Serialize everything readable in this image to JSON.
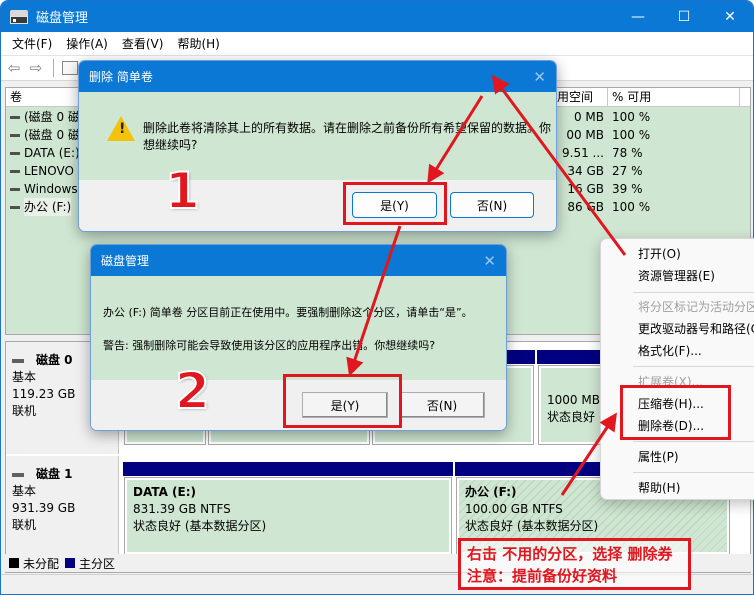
{
  "window": {
    "title": "磁盘管理",
    "controls": {
      "minimize": "—",
      "maximize": "☐",
      "close": "✕"
    }
  },
  "menubar": [
    "文件(F)",
    "操作(A)",
    "查看(V)",
    "帮助(H)"
  ],
  "volume_list": {
    "headers": {
      "volume": "卷",
      "free": "用空间",
      "pct_free": "% 可用"
    },
    "rows": [
      {
        "name": "(磁盘 0 磁",
        "free": "0 MB",
        "pct": "100 %"
      },
      {
        "name": "(磁盘 0 磁",
        "free": "00 MB",
        "pct": "100 %"
      },
      {
        "name": "DATA (E:)",
        "free": "9.51 ...",
        "pct": "78 %"
      },
      {
        "name": "LENOVO",
        "free": "34 GB",
        "pct": "27 %"
      },
      {
        "name": "Windows",
        "free": "16 GB",
        "pct": "39 %"
      },
      {
        "name": "办公 (F:)",
        "free": "86 GB",
        "pct": "100 %"
      }
    ]
  },
  "disks": [
    {
      "name": "磁盘 0",
      "type": "基本",
      "size": "119.23 GB",
      "status": "联机"
    },
    {
      "name": "磁盘 1",
      "type": "基本",
      "size": "931.39 GB",
      "status": "联机"
    }
  ],
  "partitions": {
    "disk0_right": {
      "size": "1000 MB",
      "status": "状态良好 ("
    },
    "data": {
      "name": "DATA  (E:)",
      "size": "831.39 GB NTFS",
      "status": "状态良好 (基本数据分区)"
    },
    "office": {
      "name": "办公  (F:)",
      "size": "100.00 GB NTFS",
      "status": "状态良好 (基本数据分区)"
    }
  },
  "legend": {
    "unallocated": "未分配",
    "primary": "主分区",
    "unallocated_color": "#000000",
    "primary_color": "#000080"
  },
  "dialog1": {
    "title": "删除 简单卷",
    "message_line1": "删除此卷将清除其上的所有数据。请在删除之前备份所有希望保留的数据。你",
    "message_line2": "想继续吗?",
    "yes": "是(Y)",
    "no": "否(N)",
    "close": "✕"
  },
  "dialog2": {
    "title": "磁盘管理",
    "message": "办公 (F:) 简单卷 分区目前正在使用中。要强制删除这个分区，请单击“是”。",
    "warning": "警告: 强制删除可能会导致使用该分区的应用程序出错。你想继续吗?",
    "yes": "是(Y)",
    "no": "否(N)",
    "close": "✕"
  },
  "context_menu": [
    {
      "label": "打开(O)",
      "disabled": false
    },
    {
      "label": "资源管理器(E)",
      "disabled": false
    },
    {
      "label": "将分区标记为活动分区",
      "disabled": true
    },
    {
      "label": "更改驱动器号和路径(C",
      "disabled": false
    },
    {
      "label": "格式化(F)...",
      "disabled": false
    },
    {
      "label": "扩展卷(X)...",
      "disabled": true
    },
    {
      "label": "压缩卷(H)...",
      "disabled": false
    },
    {
      "label": "删除卷(D)...",
      "disabled": false
    },
    {
      "label": "属性(P)",
      "disabled": false
    },
    {
      "label": "帮助(H)",
      "disabled": false
    }
  ],
  "annotations": {
    "step1": "1",
    "step2": "2",
    "note_line1": "右击 不用的分区，选择  删除券",
    "note_line2": "注意：提前备份好资料",
    "color": "#e0171f"
  }
}
